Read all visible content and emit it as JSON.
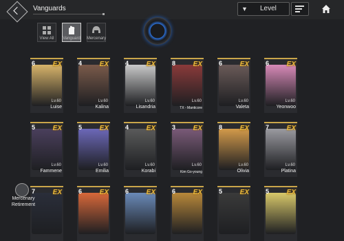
{
  "header": {
    "title": "Vanguards",
    "sort_label": "Level",
    "icons": [
      "back-icon",
      "funnel-icon",
      "sort-order-icon",
      "home-icon"
    ]
  },
  "filters": [
    {
      "label": "View All",
      "icon": "grid-icon",
      "active": false
    },
    {
      "label": "Vanguard",
      "icon": "hand-icon",
      "active": true
    },
    {
      "label": "Mercenary",
      "icon": "helmet-icon",
      "active": false
    }
  ],
  "retire_button": {
    "line1": "Mercenary",
    "line2": "Retirement"
  },
  "cards": [
    {
      "name": "Luise",
      "stars": "6",
      "level": "Lv.60",
      "rank": "EX",
      "color": "#d8b46a"
    },
    {
      "name": "Kalina",
      "stars": "4",
      "level": "Lv.60",
      "rank": "EX",
      "color": "#7a5a4a"
    },
    {
      "name": "Lisandria",
      "stars": "4",
      "level": "Lv.60",
      "rank": "EX",
      "color": "#c9c9c9"
    },
    {
      "name": "TX - Manticore",
      "stars": "8",
      "level": "Lv.60",
      "rank": "EX",
      "color": "#8a3a3a"
    },
    {
      "name": "Valeta",
      "stars": "6",
      "level": "Lv.60",
      "rank": "EX",
      "color": "#6a5a58"
    },
    {
      "name": "Yeonwoo",
      "stars": "6",
      "level": "Lv.60",
      "rank": "EX",
      "color": "#d88ab8"
    },
    {
      "name": "Fammene",
      "stars": "5",
      "level": "Lv.60",
      "rank": "EX",
      "color": "#4a3f5c"
    },
    {
      "name": "Emilia",
      "stars": "5",
      "level": "Lv.60",
      "rank": "EX",
      "color": "#6c68b8"
    },
    {
      "name": "Korabi",
      "stars": "4",
      "level": "Lv.60",
      "rank": "EX",
      "color": "#5a5a5a"
    },
    {
      "name": "Kim Go-young",
      "stars": "3",
      "level": "Lv.60",
      "rank": "EX",
      "color": "#7a5a78"
    },
    {
      "name": "Olivia",
      "stars": "8",
      "level": "Lv.60",
      "rank": "EX",
      "color": "#d29a4a"
    },
    {
      "name": "Platina",
      "stars": "7",
      "level": "Lv.60",
      "rank": "EX",
      "color": "#9a9aa0"
    },
    {
      "name": "",
      "stars": "7",
      "level": "",
      "rank": "EX",
      "color": "#2a2e3a"
    },
    {
      "name": "",
      "stars": "6",
      "level": "",
      "rank": "EX",
      "color": "#d8683a"
    },
    {
      "name": "",
      "stars": "6",
      "level": "",
      "rank": "EX",
      "color": "#6a8ab8"
    },
    {
      "name": "",
      "stars": "6",
      "level": "",
      "rank": "EX",
      "color": "#b8883a"
    },
    {
      "name": "",
      "stars": "5",
      "level": "",
      "rank": "EX",
      "color": "#3a3a3a"
    },
    {
      "name": "",
      "stars": "5",
      "level": "",
      "rank": "EX",
      "color": "#d8c86a"
    }
  ]
}
